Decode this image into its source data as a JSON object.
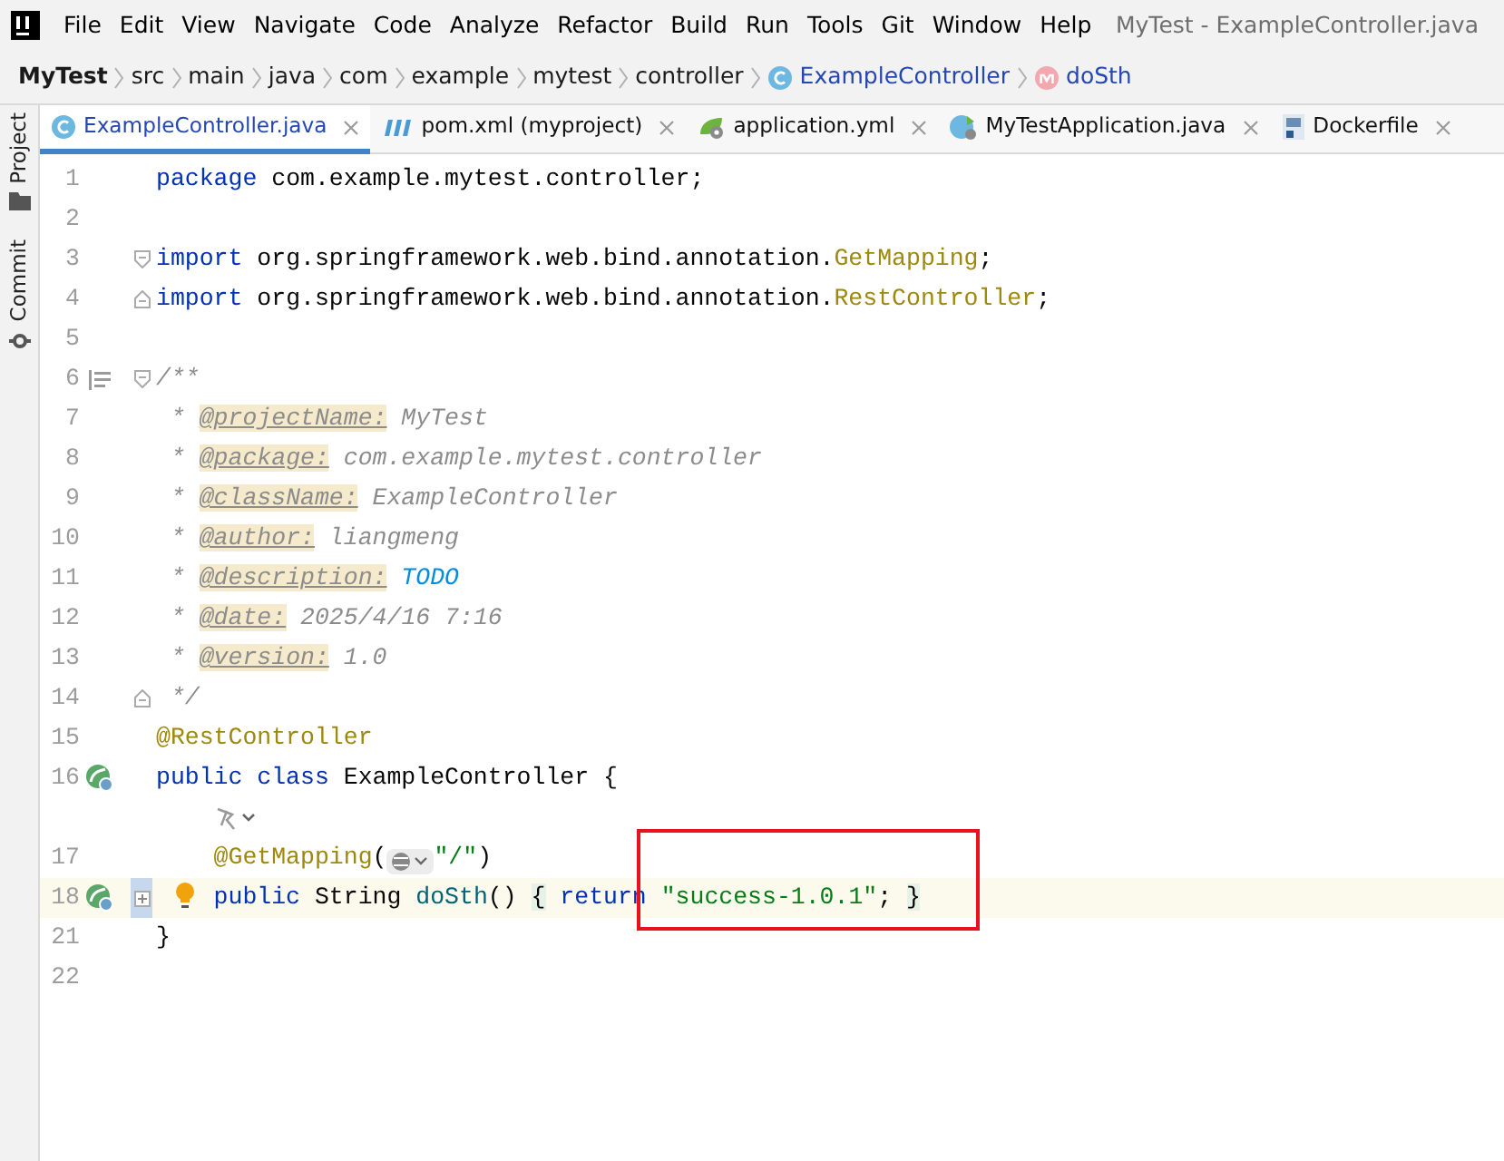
{
  "menu": [
    "File",
    "Edit",
    "View",
    "Navigate",
    "Code",
    "Analyze",
    "Refactor",
    "Build",
    "Run",
    "Tools",
    "Git",
    "Window",
    "Help"
  ],
  "window_title": "MyTest - ExampleController.java",
  "breadcrumbs": [
    {
      "text": "MyTest",
      "kind": "project"
    },
    {
      "text": "src",
      "kind": "folder"
    },
    {
      "text": "main",
      "kind": "folder"
    },
    {
      "text": "java",
      "kind": "folder"
    },
    {
      "text": "com",
      "kind": "folder"
    },
    {
      "text": "example",
      "kind": "folder"
    },
    {
      "text": "mytest",
      "kind": "folder"
    },
    {
      "text": "controller",
      "kind": "folder"
    },
    {
      "text": "ExampleController",
      "kind": "class"
    },
    {
      "text": "doSth",
      "kind": "method"
    }
  ],
  "tool_windows": [
    {
      "label": "Project",
      "kind": "folder"
    },
    {
      "label": "Commit",
      "kind": "commit"
    }
  ],
  "tabs": [
    {
      "label": "ExampleController.java",
      "kind": "class",
      "selected": true
    },
    {
      "label": "pom.xml (myproject)",
      "kind": "maven",
      "selected": false
    },
    {
      "label": "application.yml",
      "kind": "spring",
      "selected": false
    },
    {
      "label": "MyTestApplication.java",
      "kind": "app",
      "selected": false
    },
    {
      "label": "Dockerfile",
      "kind": "docker",
      "selected": false
    }
  ],
  "lines": [
    {
      "number": "1",
      "tokens": [
        {
          "kind": "kw",
          "text": "package"
        },
        {
          "kind": "plain",
          "text": " com.example.mytest.controller;"
        }
      ]
    },
    {
      "number": "2"
    },
    {
      "number": "3",
      "fold_start": true,
      "tokens": [
        {
          "kind": "kw",
          "text": "import"
        },
        {
          "kind": "plain",
          "text": " org.springframework.web.bind.annotation."
        },
        {
          "kind": "anno",
          "text": "GetMapping"
        },
        {
          "kind": "plain",
          "text": ";"
        }
      ]
    },
    {
      "number": "4",
      "fold_end": true,
      "tokens": [
        {
          "kind": "kw",
          "text": "import"
        },
        {
          "kind": "plain",
          "text": " org.springframework.web.bind.annotation."
        },
        {
          "kind": "anno",
          "text": "RestController"
        },
        {
          "kind": "plain",
          "text": ";"
        }
      ]
    },
    {
      "number": "5"
    },
    {
      "number": "6",
      "fold_start": true,
      "doc_toggle": true,
      "tokens": [
        {
          "kind": "doc",
          "text": "/**"
        }
      ]
    },
    {
      "number": "7",
      "tokens": [
        {
          "kind": "doc",
          "text": " * "
        },
        {
          "kind": "tag",
          "text": "@projectName:"
        },
        {
          "kind": "doc",
          "text": " MyTest"
        }
      ]
    },
    {
      "number": "8",
      "tokens": [
        {
          "kind": "doc",
          "text": " * "
        },
        {
          "kind": "tag",
          "text": "@package:"
        },
        {
          "kind": "doc",
          "text": " com.example.mytest.controller"
        }
      ]
    },
    {
      "number": "9",
      "tokens": [
        {
          "kind": "doc",
          "text": " * "
        },
        {
          "kind": "tag",
          "text": "@className:"
        },
        {
          "kind": "doc",
          "text": " ExampleController"
        }
      ]
    },
    {
      "number": "10",
      "tokens": [
        {
          "kind": "doc",
          "text": " * "
        },
        {
          "kind": "tag",
          "text": "@author:"
        },
        {
          "kind": "doc",
          "text": " liangmeng"
        }
      ]
    },
    {
      "number": "11",
      "tokens": [
        {
          "kind": "doc",
          "text": " * "
        },
        {
          "kind": "tag",
          "text": "@description:"
        },
        {
          "kind": "todo",
          "text": " TODO"
        }
      ]
    },
    {
      "number": "12",
      "tokens": [
        {
          "kind": "doc",
          "text": " * "
        },
        {
          "kind": "tag",
          "text": "@date:"
        },
        {
          "kind": "doc",
          "text": " 2025/4/16 7:16"
        }
      ]
    },
    {
      "number": "13",
      "tokens": [
        {
          "kind": "doc",
          "text": " * "
        },
        {
          "kind": "tag",
          "text": "@version:"
        },
        {
          "kind": "doc",
          "text": " 1.0"
        }
      ]
    },
    {
      "number": "14",
      "fold_end": true,
      "tokens": [
        {
          "kind": "doc",
          "text": " */"
        }
      ]
    },
    {
      "number": "15",
      "tokens": [
        {
          "kind": "anno",
          "text": "@RestController"
        }
      ]
    },
    {
      "number": "16",
      "spring_marker": true,
      "tokens": [
        {
          "kind": "kw",
          "text": "public class"
        },
        {
          "kind": "plain",
          "text": " ExampleController {"
        }
      ]
    },
    {
      "kind": "inlay"
    },
    {
      "number": "17",
      "tokens": [
        {
          "kind": "anno",
          "text": "    @GetMapping"
        },
        {
          "kind": "plain",
          "text": "("
        },
        {
          "kind": "hint"
        },
        {
          "kind": "str",
          "text": "\"/\""
        },
        {
          "kind": "plain",
          "text": ")"
        }
      ]
    },
    {
      "number": "18",
      "spring_marker": true,
      "folded": true,
      "current": true,
      "bulb": true,
      "tokens": [
        {
          "kind": "kw",
          "text": "    public"
        },
        {
          "kind": "plain",
          "text": " String "
        },
        {
          "kind": "method",
          "text": "doSth"
        },
        {
          "kind": "plain",
          "text": "() "
        },
        {
          "kind": "folded",
          "text": "{"
        },
        {
          "kind": "kw",
          "text": " return"
        },
        {
          "kind": "str",
          "text": " \"success-1.0.1\""
        },
        {
          "kind": "plain",
          "text": "; "
        },
        {
          "kind": "folded",
          "text": "}"
        }
      ]
    },
    {
      "number": "21",
      "tokens": [
        {
          "kind": "plain",
          "text": "}"
        }
      ]
    },
    {
      "number": "22"
    }
  ],
  "highlight_box": true
}
